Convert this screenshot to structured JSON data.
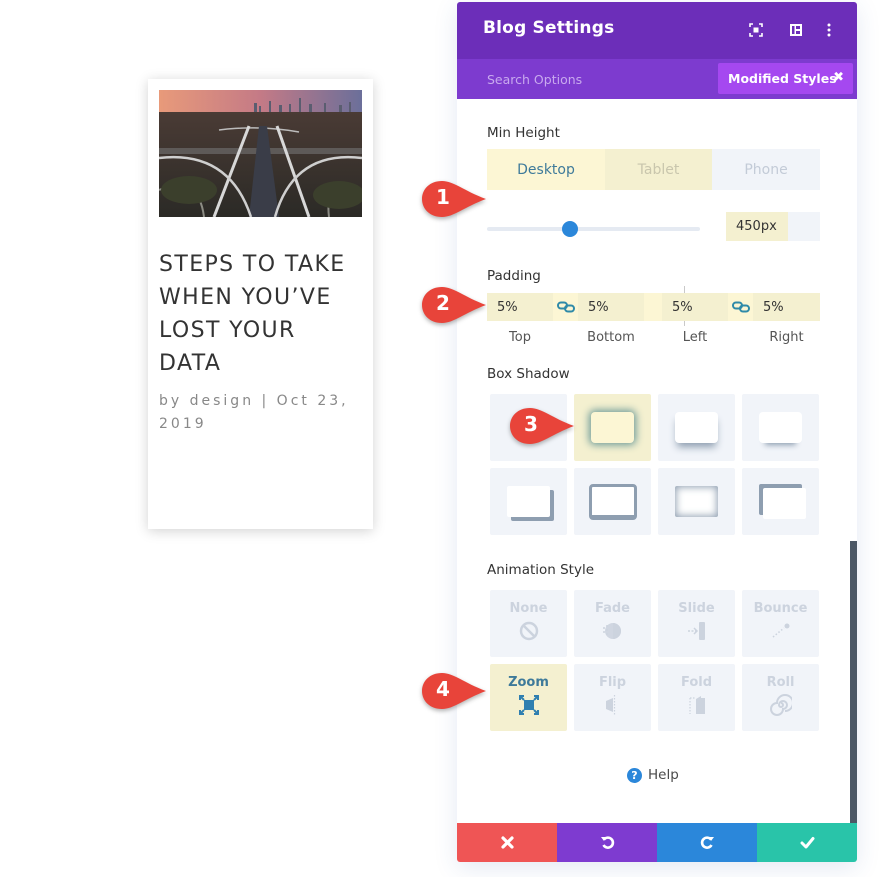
{
  "card": {
    "image_alt": "Aerial view of highway interchange at dusk with city skyline",
    "title": "STEPS TO TAKE WHEN YOU’VE LOST YOUR DATA",
    "meta": "by design | Oct 23, 2019"
  },
  "panel": {
    "title": "Blog Settings",
    "header_icons": [
      "expand-icon",
      "columns-icon",
      "more-vertical-icon"
    ],
    "search_placeholder": "Search Options",
    "modified_styles_label": "Modified Styles",
    "modified_styles_close": "✖"
  },
  "min_height": {
    "label": "Min Height",
    "tabs": [
      {
        "label": "Desktop",
        "active": true
      },
      {
        "label": "Tablet",
        "active": false
      },
      {
        "label": "Phone",
        "active": false
      }
    ],
    "slider_fraction": 0.39,
    "value": "450px"
  },
  "padding": {
    "label": "Padding",
    "fields": [
      {
        "side": "Top",
        "value": "5%"
      },
      {
        "side": "Bottom",
        "value": "5%"
      },
      {
        "side": "Left",
        "value": "5%"
      },
      {
        "side": "Right",
        "value": "5%"
      }
    ]
  },
  "box_shadow": {
    "label": "Box Shadow",
    "selected_index": 1,
    "option_count": 8
  },
  "animation": {
    "label": "Animation Style",
    "options": [
      {
        "label": "None",
        "icon": "none-icon"
      },
      {
        "label": "Fade",
        "icon": "fade-icon"
      },
      {
        "label": "Slide",
        "icon": "slide-icon"
      },
      {
        "label": "Bounce",
        "icon": "bounce-icon"
      },
      {
        "label": "Zoom",
        "icon": "zoom-icon",
        "active": true
      },
      {
        "label": "Flip",
        "icon": "flip-icon"
      },
      {
        "label": "Fold",
        "icon": "fold-icon"
      },
      {
        "label": "Roll",
        "icon": "roll-icon"
      }
    ]
  },
  "help": {
    "label": "Help",
    "icon": "?"
  },
  "footer": {
    "buttons": [
      {
        "name": "discard",
        "icon": "close-icon",
        "color": "#ef5555"
      },
      {
        "name": "undo",
        "icon": "undo-icon",
        "color": "#7e3bd0"
      },
      {
        "name": "redo",
        "icon": "redo-icon",
        "color": "#2b87da"
      },
      {
        "name": "save",
        "icon": "check-icon",
        "color": "#29c4a9"
      }
    ]
  },
  "callouts": [
    "1",
    "2",
    "3",
    "4"
  ],
  "colors": {
    "header_purple": "#6c2eb9",
    "subheader_purple": "#7d3bcf",
    "modified_purple": "#a548f0",
    "accent_blue": "#2b87da",
    "selected_yellow": "#f4f0d0",
    "callout_red": "#e8443a"
  }
}
